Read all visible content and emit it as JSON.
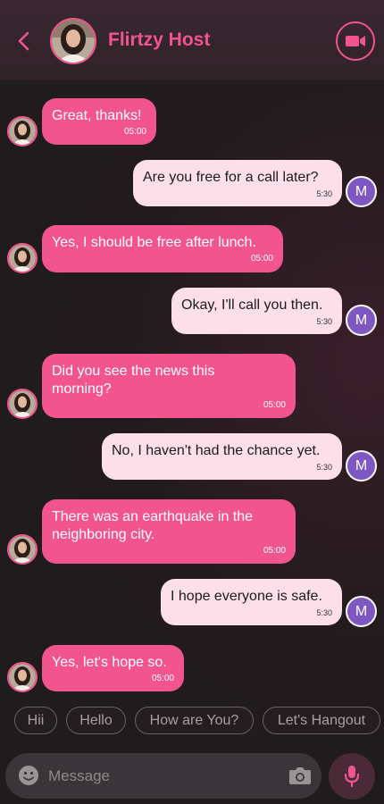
{
  "header": {
    "title": "Flirtzy Host",
    "back_icon": "chevron-left-icon",
    "video_icon": "video-camera-icon",
    "accent": "#f2558d"
  },
  "user_initial": "M",
  "messages": [
    {
      "from": "host",
      "text": "Great, thanks!",
      "time": "05:00"
    },
    {
      "from": "user",
      "text": "Are you free for a call later?",
      "time": "5:30"
    },
    {
      "from": "host",
      "text": "Yes, I should be free after lunch.",
      "time": "05:00"
    },
    {
      "from": "user",
      "text": "Okay, I'll call you then.",
      "time": "5:30"
    },
    {
      "from": "host",
      "text": "Did you see the news this\nmorning?",
      "time": "05:00"
    },
    {
      "from": "user",
      "text": "No, I haven't had the chance yet.",
      "time": "5:30"
    },
    {
      "from": "host",
      "text": "There was an earthquake in the\nneighboring city.",
      "time": "05:00"
    },
    {
      "from": "user",
      "text": "I hope everyone is safe.",
      "time": "5:30"
    },
    {
      "from": "host",
      "text": "Yes, let's hope so.",
      "time": "05:00"
    }
  ],
  "quick_replies": [
    "Hii",
    "Hello",
    "How are You?",
    "Let's Hangout"
  ],
  "composer": {
    "placeholder": "Message",
    "emoji_icon": "emoji-icon",
    "camera_icon": "camera-icon",
    "mic_icon": "microphone-icon"
  },
  "colors": {
    "incoming_bubble": "#f2558d",
    "outgoing_bubble": "#fcdfe9",
    "user_avatar": "#7e57c2"
  }
}
